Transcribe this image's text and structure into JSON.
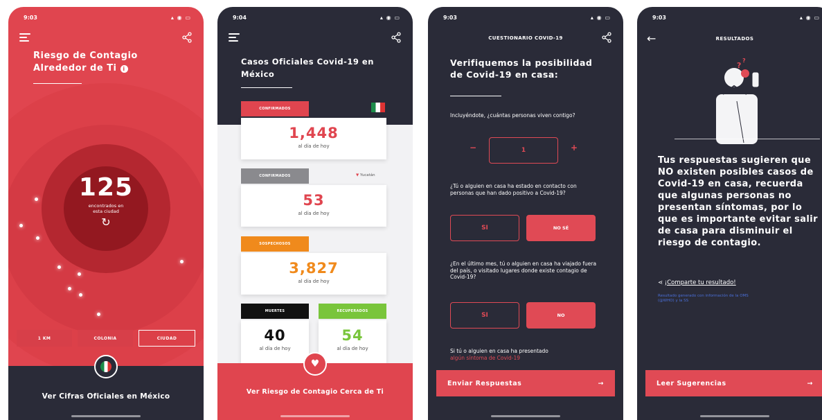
{
  "phone1": {
    "time": "9:03",
    "title_line1": "Riesgo de Contagio",
    "title_line2": "Alrededor de Ti",
    "count": "125",
    "count_caption_line1": "encontrados en",
    "count_caption_line2": "esta ciudad",
    "chips": [
      "1 KM",
      "COLONIA",
      "CIUDAD"
    ],
    "bottom_label": "Ver Cifras Oficiales en México",
    "colors": {
      "bg": "#e0454f",
      "nav": "#2a2b38"
    }
  },
  "phone2": {
    "time": "9:04",
    "title_line1": "Casos Oficiales Covid-19 en",
    "title_line2": "México",
    "confirmed": {
      "tag": "CONFIRMADOS",
      "value": "1,448",
      "caption": "al día de hoy"
    },
    "suspected": {
      "tag": "CONFIRMADOS",
      "value": "53",
      "caption": "al día de hoy",
      "location": "Yucatán"
    },
    "negative": {
      "tag": "SOSPECHOSOS",
      "value": "3,827",
      "caption": "al día de hoy"
    },
    "deaths": {
      "tag": "MUERTES",
      "value": "40",
      "caption": "al día de hoy"
    },
    "recovered": {
      "tag": "RECUPERADOS",
      "value": "54",
      "caption": "al día de hoy"
    },
    "bottom_label": "Ver Riesgo de Contagio Cerca de Ti",
    "colors": {
      "red": "#e0454f",
      "gray": "#8a8a8e",
      "orange": "#f08a1c",
      "black": "#111111",
      "green": "#79c53b"
    }
  },
  "phone3": {
    "time": "9:03",
    "header": "CUESTIONARIO COVID-19",
    "title_line1": "Verifiquemos la posibilidad",
    "title_line2": "de Covid-19 en casa:",
    "q1": "Incluyéndote, ¿cuántas personas viven contigo?",
    "q1_value": "1",
    "q2": "¿Tú o alguien en casa ha estado en contacto con personas que han dado positivo a Covid-19?",
    "q2_options": [
      "SI",
      "NO SÉ"
    ],
    "q3": "¿En el último mes, tú o alguien en casa ha viajado fuera del país, o visitado lugares donde existe contagio de Covid-19?",
    "q3_options": [
      "SI",
      "NO"
    ],
    "q4": "Si tú o alguien en casa ha presentado",
    "q4_link": "algún síntoma de Covid-19",
    "cta": "Enviar Respuestas"
  },
  "phone4": {
    "time": "9:03",
    "header": "RESULTADOS",
    "result_text": "Tus respuestas sugieren que NO existen posibles casos de Covid-19 en casa, recuerda que algunas personas no presentan síntomas, por lo que es importante evitar salir de casa para disminuir el riesgo de contagio.",
    "share_label": "¡Comparte tu resultado!",
    "source_note": "Resultado generado con información de la OMS (@WHO) y la SS",
    "cta": "Leer Sugerencias"
  }
}
